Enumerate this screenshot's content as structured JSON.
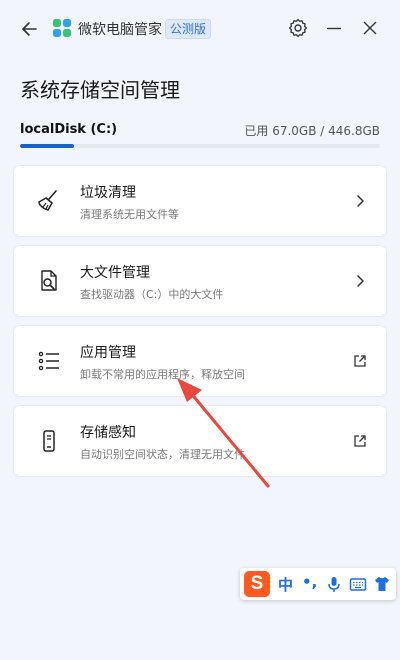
{
  "window": {
    "app_title": "微软电脑管家",
    "edition_badge": "公测版"
  },
  "page": {
    "title": "系统存储空间管理"
  },
  "disk": {
    "name": "localDisk (C:)",
    "usage_text": "已用 67.0GB / 446.8GB",
    "used_fraction": 0.15
  },
  "cards": [
    {
      "title": "垃圾清理",
      "desc": "清理系统无用文件等",
      "icon": "broom-icon",
      "action": "chevron-right-icon"
    },
    {
      "title": "大文件管理",
      "desc": "查找驱动器（C:）中的大文件",
      "icon": "file-search-icon",
      "action": "chevron-right-icon"
    },
    {
      "title": "应用管理",
      "desc": "卸载不常用的应用程序，释放空间",
      "icon": "list-icon",
      "action": "external-link-icon"
    },
    {
      "title": "存储感知",
      "desc": "自动识别空间状态，清理无用文件",
      "icon": "phone-icon",
      "action": "external-link-icon"
    }
  ],
  "ime": {
    "logo": "S",
    "mode": "中",
    "punct": "•,"
  },
  "colors": {
    "accent": "#1763c9",
    "annotation_arrow": "#e8483f",
    "ime_brand": "#ff5a1f"
  }
}
